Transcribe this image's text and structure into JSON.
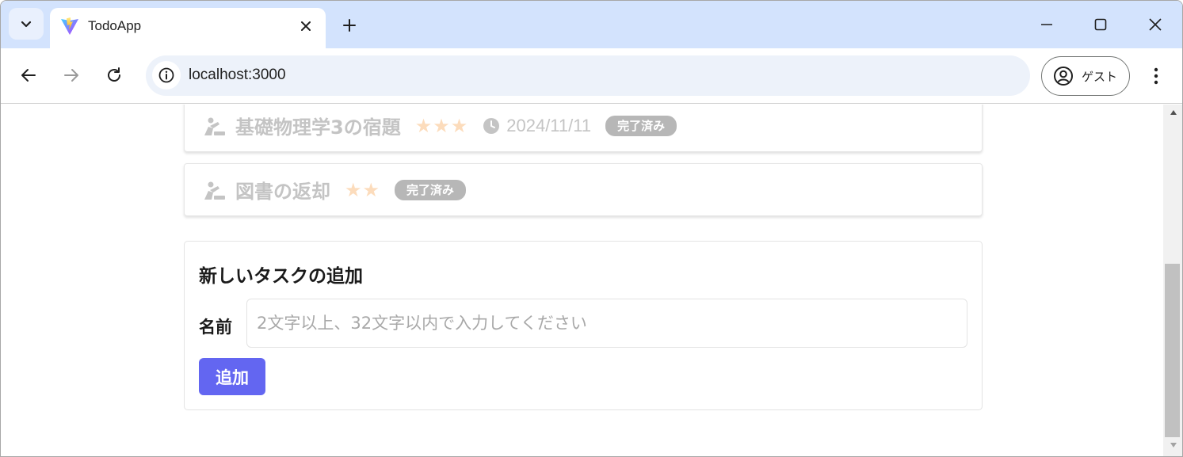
{
  "browser": {
    "tab_title": "TodoApp",
    "url": "localhost:3000",
    "profile_label": "ゲスト"
  },
  "tasks": [
    {
      "name": "基礎物理学3の宿題",
      "stars": "★★★",
      "priority": 3,
      "due": "2024/11/11",
      "status": "完了済み"
    },
    {
      "name": "図書の返却",
      "stars": "★★",
      "priority": 2,
      "status": "完了済み"
    }
  ],
  "form": {
    "title": "新しいタスクの追加",
    "name_label": "名前",
    "name_placeholder": "2文字以上、32文字以内で入力してください",
    "name_value": "",
    "submit_label": "追加"
  },
  "colors": {
    "accent": "#6366f1",
    "tabstrip": "#d3e3fd",
    "done_text": "#c4c4c4",
    "star": "#fcdcbc",
    "badge": "#b7b7b7"
  },
  "scroll": {
    "thumb_position_fraction": 0.55
  }
}
